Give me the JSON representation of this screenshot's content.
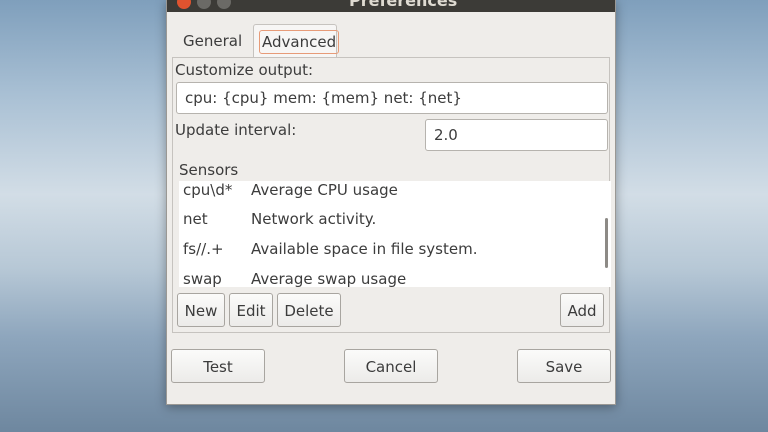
{
  "window": {
    "title": "Preferences"
  },
  "tabs": [
    {
      "label": "General"
    },
    {
      "label": "Advanced"
    }
  ],
  "advanced": {
    "customize_output_label": "Customize output:",
    "customize_output_value": "cpu: {cpu} mem: {mem} net: {net}",
    "update_interval_label": "Update interval:",
    "update_interval_value": "2.0",
    "sensors_label": "Sensors",
    "sensors": [
      {
        "key": "cpu\\d*",
        "desc": "Average CPU usage"
      },
      {
        "key": "net",
        "desc": "Network activity."
      },
      {
        "key": "fs//.+",
        "desc": "Available space in file system."
      },
      {
        "key": "swap",
        "desc": "Average swap usage"
      }
    ],
    "buttons": {
      "new": "New",
      "edit": "Edit",
      "delete": "Delete",
      "add": "Add"
    }
  },
  "footer": {
    "test": "Test",
    "cancel": "Cancel",
    "save": "Save"
  },
  "colors": {
    "titlebar": "#3c3b37",
    "close": "#e0532f",
    "tab_focus": "#e79b78"
  }
}
